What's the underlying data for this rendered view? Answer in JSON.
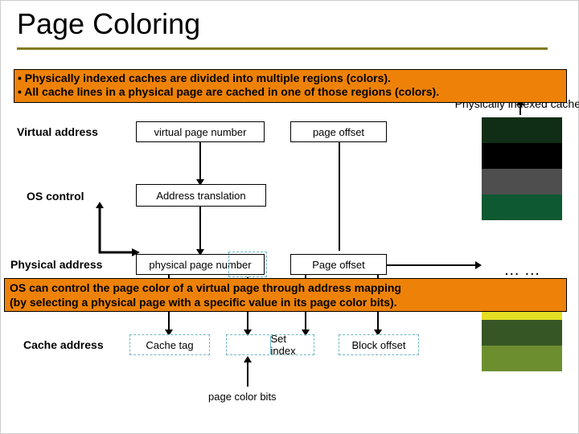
{
  "title": "Page Coloring",
  "hidden_right_label": "Physically indexed cache",
  "callout1": {
    "line1": "• Physically indexed caches are divided into multiple regions (colors).",
    "line2": "• All cache lines in a physical page are cached in one of those regions (colors)."
  },
  "labels": {
    "virtual": "Virtual address",
    "oscontrol": "OS control",
    "physical": "Physical address",
    "cache": "Cache address"
  },
  "virtual_row": {
    "vpn": "virtual page number",
    "offset": "page offset"
  },
  "address_translation": "Address translation",
  "physical_row": {
    "ppn": "physical page number",
    "offset": "Page offset"
  },
  "cache_row": {
    "tag": "Cache tag",
    "set": "Set index",
    "block": "Block offset"
  },
  "callout2": {
    "line1": "OS can control the page color of a virtual page through address mapping",
    "line2": "(by selecting a physical page with a specific value in its page color bits)."
  },
  "page_color_bits_label": "page color bits",
  "ellipsis": "… …",
  "color_stack_top": [
    "#0f2e15",
    "#000000",
    "#4e4e4e",
    "#0e5832",
    "#ffffff"
  ],
  "color_stack_bottom": [
    "#e4de24",
    "#375626",
    "#6d8e2f"
  ]
}
